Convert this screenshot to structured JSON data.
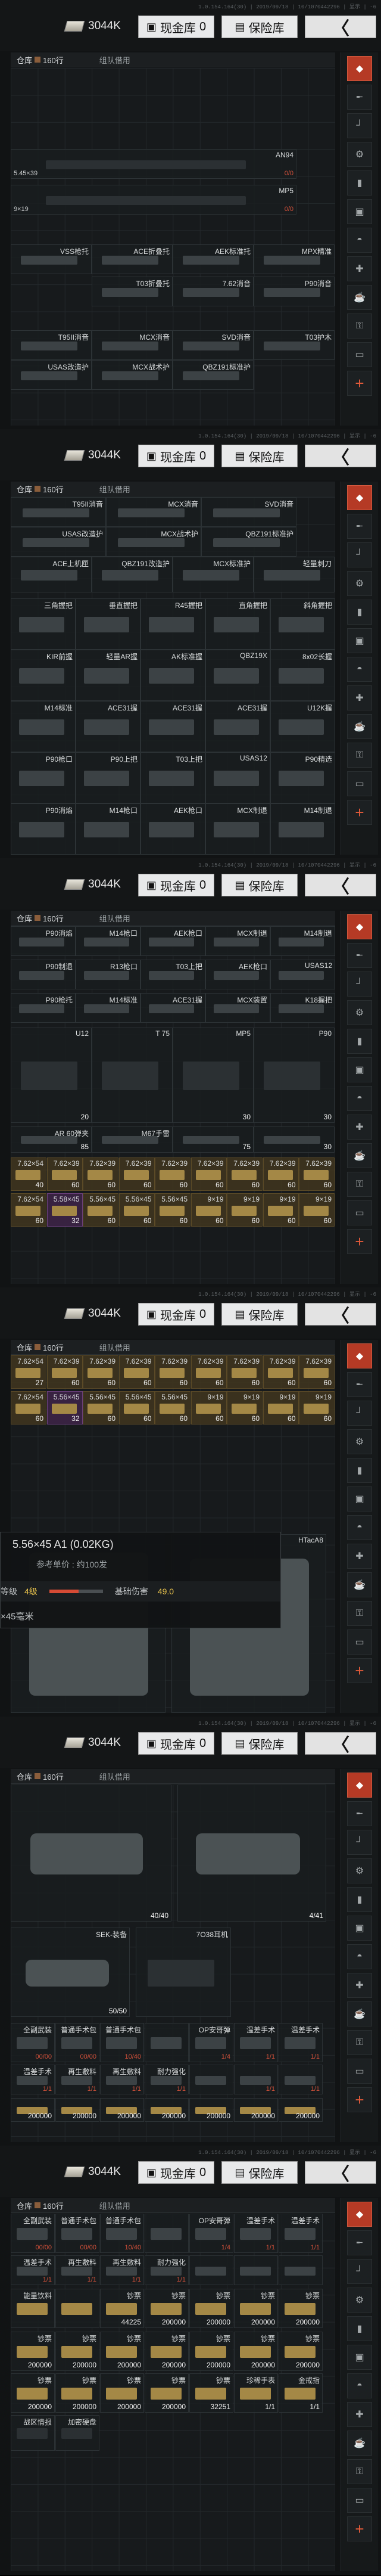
{
  "header": {
    "build": "1.0.154.164(30) | 2019/09/18 | 10/1070442296 | 显示 | -6",
    "money": "3044K",
    "cash_label": "现金库",
    "cash_count": "0",
    "safe_label": "保险库",
    "back_label": "〈"
  },
  "tabs": {
    "warehouse": "仓库",
    "capacity": "160行",
    "team": "组队借用"
  },
  "rail": {
    "icons": [
      "backpack-icon",
      "rifle-icon",
      "pistol-icon",
      "attachment-icon",
      "ammo-icon",
      "armor-icon",
      "helmet-icon",
      "med-icon",
      "food-icon",
      "key-icon",
      "case-icon",
      "add-icon"
    ]
  },
  "s1": {
    "weapons": [
      {
        "name": "AN94",
        "sub": "5.45×39",
        "red": "0/0"
      },
      {
        "name": "MP5",
        "sub": "9×19",
        "red": "0/0"
      }
    ],
    "row1": [
      "VSS枪托",
      "ACE折叠托",
      "AEK标准托",
      "MPX精准"
    ],
    "row2": [
      "T03折叠托",
      "7.62消音",
      "P90消音"
    ],
    "row3": [
      "T95II消音",
      "MCX消音",
      "SVD消音",
      "T03护木"
    ],
    "row4": [
      "USAS改造护",
      "MCX战术护",
      "QBZ191标准护"
    ]
  },
  "s2": {
    "row1": [
      "T95II消音",
      "MCX消音",
      "SVD消音"
    ],
    "row2": [
      "USAS改造护",
      "MCX战术护",
      "QBZ191标准护"
    ],
    "row3": [
      "ACE上机匣",
      "QBZ191改造护",
      "MCX标准护",
      "轻量刺刀"
    ],
    "row4": [
      "三角握把",
      "垂直握把",
      "R45握把",
      "直角握把",
      "斜角握把"
    ],
    "row5": [
      "KIR前握",
      "轻量AR握",
      "AK标准握",
      "QBZ19X",
      "8x02长握"
    ],
    "row6": [
      "M14标准",
      "ACE31握",
      "ACE31握",
      "ACE31握",
      "U12K握"
    ],
    "row7": [
      "P90枪口",
      "P90上把",
      "T03上把",
      "USAS12",
      "P90精选"
    ],
    "row8": [
      "P90消焰",
      "M14枪口",
      "AEK枪口",
      "MCX制退",
      "M14制退"
    ]
  },
  "s3": {
    "row1": [
      "P90消焰",
      "M14枪口",
      "AEK枪口",
      "MCX制退",
      "M14制退"
    ],
    "row2": [
      "P90制退",
      "R13枪口",
      "T03上把",
      "AEK枪口",
      "USAS12"
    ],
    "row3": [
      "P90枪托",
      "M14标准",
      "ACE31握",
      "MCX装置",
      "K18握把"
    ],
    "mags": [
      {
        "name": "U12",
        "n": "20"
      },
      {
        "name": "T 75",
        "n": ""
      },
      {
        "name": "MP5",
        "n": "30"
      },
      {
        "name": "P90",
        "n": "30"
      }
    ],
    "mag_counts": [
      "M14",
      "20"
    ],
    "row5": [
      {
        "name": "AR 60弹夹",
        "n": "85"
      },
      {
        "name": "M67手雷",
        "n": ""
      },
      {
        "name": "",
        "n": "75"
      },
      {
        "name": "",
        "n": "30"
      }
    ],
    "ammo_top": [
      {
        "name": "7.62×54",
        "n": "40"
      },
      {
        "name": "7.62×39",
        "n": "60"
      },
      {
        "name": "7.62×39",
        "n": "60"
      },
      {
        "name": "7.62×39",
        "n": "60"
      },
      {
        "name": "7.62×39",
        "n": "60"
      },
      {
        "name": "7.62×39",
        "n": "60"
      },
      {
        "name": "7.62×39",
        "n": "60"
      },
      {
        "name": "7.62×39",
        "n": "60"
      },
      {
        "name": "7.62×39",
        "n": "60"
      }
    ],
    "ammo_bottom": [
      {
        "name": "7.62×54",
        "n": "60"
      },
      {
        "name": "5.58×45",
        "n": "32"
      },
      {
        "name": "5.56×45",
        "n": "60"
      },
      {
        "name": "5.56×45",
        "n": "60"
      },
      {
        "name": "5.56×45",
        "n": "60"
      },
      {
        "name": "9×19",
        "n": "60"
      },
      {
        "name": "9×19",
        "n": "60"
      },
      {
        "name": "9×19",
        "n": "60"
      },
      {
        "name": "9×19",
        "n": "60"
      }
    ]
  },
  "s4": {
    "ammo_top": [
      {
        "name": "7.62×54",
        "n": "27"
      },
      {
        "name": "7.62×39",
        "n": "60"
      },
      {
        "name": "7.62×39",
        "n": "60"
      },
      {
        "name": "7.62×39",
        "n": "60"
      },
      {
        "name": "7.62×39",
        "n": "60"
      },
      {
        "name": "7.62×39",
        "n": "60"
      },
      {
        "name": "7.62×39",
        "n": "60"
      },
      {
        "name": "7.62×39",
        "n": "60"
      },
      {
        "name": "7.62×39",
        "n": "60"
      }
    ],
    "ammo_bottom": [
      {
        "name": "7.62×54",
        "n": "60"
      },
      {
        "name": "5.56×45",
        "n": "32"
      },
      {
        "name": "5.56×45",
        "n": "60"
      },
      {
        "name": "5.56×45",
        "n": "60"
      },
      {
        "name": "5.56×45",
        "n": "60"
      },
      {
        "name": "9×19",
        "n": "60"
      },
      {
        "name": "9×19",
        "n": "60"
      },
      {
        "name": "9×19",
        "n": "60"
      },
      {
        "name": "9×19",
        "n": "60"
      }
    ],
    "popup": {
      "title": "5.56×45 A1 (0.02KG)",
      "ref_label": "参考单价",
      "ref_value": "约100发",
      "level_label": "等级",
      "level_value": "4级",
      "level_fraction": 0.55,
      "damage_label": "基础伤害",
      "damage_value": "49.0",
      "foot": "×45毫米"
    },
    "vest_name": "HTacA8"
  },
  "s5": {
    "vest_count": "40/40",
    "vest2_count": "4/41",
    "sek_name": "SEK-装备",
    "sek_count": "50/50",
    "headset": "7O38耳机",
    "row_items": [
      {
        "name": "全副武装",
        "n": "00/00"
      },
      {
        "name": "普通手术包",
        "n": "00/00"
      },
      {
        "name": "普通手术包",
        "n": "10/40"
      },
      {
        "name": "",
        "n": ""
      },
      {
        "name": "OP安哥弹",
        "n": "1/4"
      },
      {
        "name": "温差手术",
        "n": "1/1"
      },
      {
        "name": "温差手术",
        "n": "1/1"
      }
    ],
    "row_small": [
      {
        "name": "温差手术",
        "n": "1/1"
      },
      {
        "name": "再生敷料",
        "n": "1/1"
      },
      {
        "name": "再生敷料",
        "n": "1/1"
      },
      {
        "name": "耐力强化",
        "n": "1/1"
      },
      {
        "name": "",
        "n": ""
      },
      {
        "name": "",
        "n": "1/1"
      },
      {
        "name": "",
        "n": "1/1"
      }
    ],
    "money_row": [
      "200000",
      "200000",
      "200000",
      "200000",
      "200000",
      "200000",
      "200000"
    ]
  },
  "s6": {
    "row1": [
      {
        "name": "全副武装",
        "n": "00/00"
      },
      {
        "name": "普通手术包",
        "n": "00/00"
      },
      {
        "name": "普通手术包",
        "n": "10/40"
      },
      {
        "name": "",
        "n": ""
      },
      {
        "name": "OP安哥弹",
        "n": "1/4"
      },
      {
        "name": "温差手术",
        "n": "1/1"
      },
      {
        "name": "温差手术",
        "n": "1/1"
      }
    ],
    "row2": [
      {
        "name": "温差手术",
        "n": "1/1"
      },
      {
        "name": "再生敷料",
        "n": "1/1"
      },
      {
        "name": "再生敷料",
        "n": "1/1"
      },
      {
        "name": "耐力强化",
        "n": "1/1"
      },
      {
        "name": "",
        "n": ""
      },
      {
        "name": "",
        "n": ""
      },
      {
        "name": "",
        "n": ""
      }
    ],
    "row3": [
      {
        "name": "能量饮料",
        "n": ""
      },
      {
        "name": "",
        "n": ""
      },
      {
        "name": "钞票",
        "n": ""
      },
      {
        "name": "钞票",
        "n": ""
      },
      {
        "name": "钞票",
        "n": ""
      },
      {
        "name": "钞票",
        "n": ""
      },
      {
        "name": "钞票",
        "n": ""
      }
    ],
    "row3_vals": [
      "",
      "",
      "44225",
      "200000",
      "200000",
      "200000",
      "200000"
    ],
    "row4": [
      {
        "name": "钞票",
        "n": "200000"
      },
      {
        "name": "钞票",
        "n": "200000"
      },
      {
        "name": "钞票",
        "n": "200000"
      },
      {
        "name": "钞票",
        "n": "200000"
      },
      {
        "name": "钞票",
        "n": "200000"
      },
      {
        "name": "钞票",
        "n": "200000"
      },
      {
        "name": "钞票",
        "n": "200000"
      }
    ],
    "row5": [
      {
        "name": "钞票",
        "n": "200000"
      },
      {
        "name": "钞票",
        "n": "200000"
      },
      {
        "name": "钞票",
        "n": "200000"
      },
      {
        "name": "钞票",
        "n": "200000"
      },
      {
        "name": "钞票",
        "n": "32251"
      },
      {
        "name": "珍稀手表",
        "n": "1/1"
      },
      {
        "name": "金戒指",
        "n": "1/1"
      }
    ],
    "row6": [
      {
        "name": "战区情报",
        "n": ""
      },
      {
        "name": "加密硬盘",
        "n": ""
      }
    ]
  }
}
